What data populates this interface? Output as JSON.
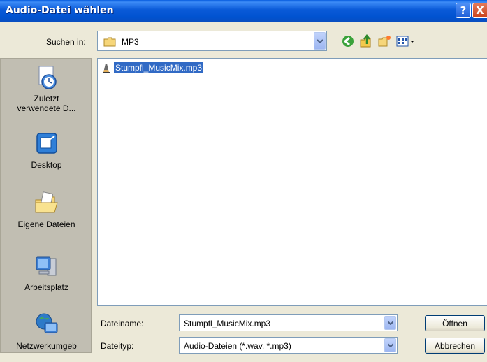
{
  "window": {
    "title": "Audio-Datei wählen",
    "help": "?",
    "close": "X"
  },
  "lookin": {
    "label": "Suchen in:",
    "value": "MP3"
  },
  "places": [
    {
      "label": "Zuletzt verwendete D..."
    },
    {
      "label": "Desktop"
    },
    {
      "label": "Eigene Dateien"
    },
    {
      "label": "Arbeitsplatz"
    },
    {
      "label": "Netzwerkumgeb"
    }
  ],
  "files": [
    {
      "name": "Stumpfl_MusicMix.mp3"
    }
  ],
  "filename": {
    "label": "Dateiname:",
    "value": "Stumpfl_MusicMix.mp3"
  },
  "filetype": {
    "label": "Dateityp:",
    "value": "Audio-Dateien (*.wav, *.mp3)"
  },
  "buttons": {
    "open": "Öffnen",
    "cancel": "Abbrechen"
  },
  "colors": {
    "titlebar": "#0a5ad8",
    "selection": "#316ac5",
    "dialog_bg": "#ece9d8"
  }
}
